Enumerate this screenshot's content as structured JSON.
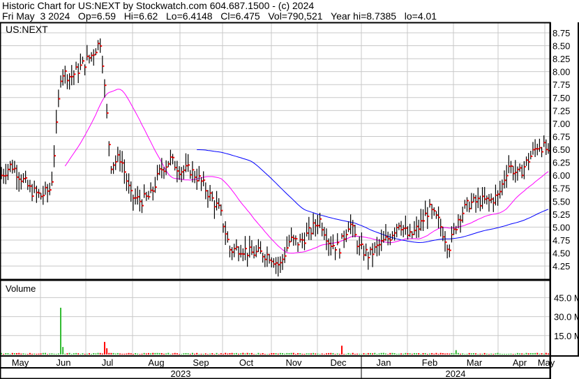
{
  "header": {
    "title": "Historic Chart for US:NEXT by Stockwatch.com 604.687.1500 - (c) 2024",
    "quote": "Fri May  3 2024   Op=6.59   Hi=6.62   Lo=6.4148   Cl=6.475   Vol=790,521   Year hi=8.7385   lo=4.01"
  },
  "chart_data": {
    "type": "ohlc",
    "symbol": "US:NEXT",
    "price_axis": {
      "ticks": [
        "8.75",
        "8.50",
        "8.25",
        "8.00",
        "7.75",
        "7.50",
        "7.25",
        "7.00",
        "6.75",
        "6.50",
        "6.25",
        "6.00",
        "5.75",
        "5.50",
        "5.25",
        "5.00",
        "4.75",
        "4.50",
        "4.25"
      ],
      "range": [
        4.0,
        8.95
      ]
    },
    "weekly_closes": [
      6.0,
      6.2,
      5.95,
      5.7,
      5.6,
      5.75,
      8.0,
      7.9,
      8.1,
      8.3,
      8.6,
      6.2,
      6.35,
      5.6,
      5.5,
      5.6,
      6.1,
      6.3,
      6.1,
      6.1,
      5.9,
      5.6,
      5.3,
      4.55,
      4.6,
      4.5,
      4.5,
      4.45,
      4.25,
      4.75,
      4.7,
      4.9,
      5.15,
      4.7,
      4.6,
      5.1,
      4.6,
      4.45,
      4.65,
      4.8,
      5.1,
      4.8,
      5.0,
      5.35,
      5.1,
      4.6,
      5.2,
      5.45,
      5.5,
      5.5,
      5.6,
      6.2,
      6.0,
      6.3,
      6.6,
      6.475
    ],
    "moving_averages": [
      {
        "period": 30,
        "color": "#ff00ff"
      },
      {
        "period": 90,
        "color": "#0000ff"
      }
    ],
    "volume": {
      "label": "Volume",
      "ticks": [
        "45.0 M",
        "30.0 M",
        "15.0 M"
      ],
      "range_millions": [
        0,
        55
      ],
      "typical_millions": 0.9,
      "spikes": [
        {
          "day": 27,
          "millions": 37,
          "up": true
        },
        {
          "day": 28,
          "millions": 6,
          "up": true
        },
        {
          "day": 47,
          "millions": 10,
          "up": false
        },
        {
          "day": 48,
          "millions": 5,
          "up": false
        },
        {
          "day": 155,
          "millions": 7,
          "up": false
        },
        {
          "day": 207,
          "millions": 3.5,
          "up": true
        }
      ]
    },
    "x_axis": {
      "months": [
        "May",
        "Jun",
        "Jul",
        "Aug",
        "Sep",
        "Oct",
        "Nov",
        "Dec",
        "Jan",
        "Feb",
        "Mar",
        "Apr",
        "May"
      ],
      "years": [
        "2023",
        "2024"
      ]
    },
    "colors": {
      "bar": "#000000",
      "close_tick": "#ff0000",
      "vol_up": "#33bb33",
      "vol_down": "#ff0000",
      "grid": "#c8c8c8"
    }
  }
}
